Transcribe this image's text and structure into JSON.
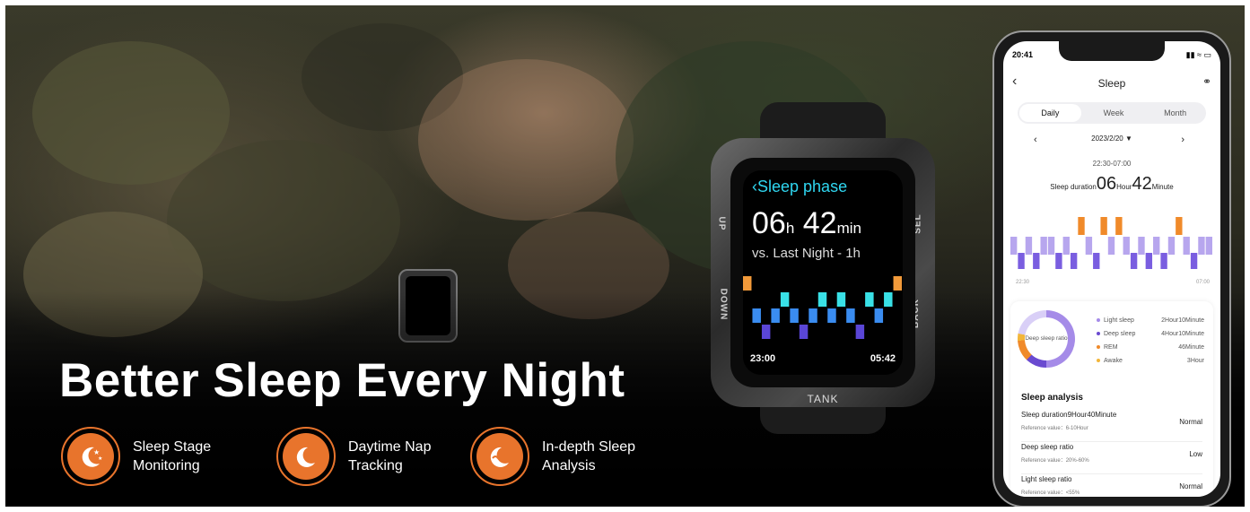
{
  "banner": {
    "headline": "Better Sleep Every Night",
    "features": [
      {
        "icon": "moon-stars-icon",
        "label": "Sleep Stage Monitoring"
      },
      {
        "icon": "moon-z-icon",
        "label": "Daytime Nap Tracking"
      },
      {
        "icon": "moon-wave-icon",
        "label": "In-depth Sleep Analysis"
      }
    ],
    "accent": "#e8742c"
  },
  "watch": {
    "title": "Sleep phase",
    "hours": "06",
    "hours_unit": "h",
    "minutes": "42",
    "minutes_unit": "min",
    "compare": "vs. Last Night - 1h",
    "start": "23:00",
    "end": "05:42",
    "brand": "TANK",
    "labels": {
      "up": "UP",
      "down": "DOWN",
      "back": "BACK",
      "sel": "SEL"
    }
  },
  "phone": {
    "status_time": "20:41",
    "title": "Sleep",
    "tabs": [
      "Daily",
      "Week",
      "Month"
    ],
    "active_tab": "Daily",
    "date": "2023/2/20",
    "range": "22:30-07:00",
    "duration_label": "Sleep duration",
    "duration_hours": "06",
    "hour_unit": "Hour",
    "duration_minutes": "42",
    "minute_unit": "Minute",
    "axis_start": "22:30",
    "axis_end": "07:00",
    "donut_label": "Deep sleep ratio",
    "legend": [
      {
        "name": "Light sleep",
        "value": "2Hour10Minute",
        "color": "#a58be8"
      },
      {
        "name": "Deep sleep",
        "value": "4Hour10Minute",
        "color": "#6a4ad0"
      },
      {
        "name": "REM",
        "value": "46Minute",
        "color": "#f08a2a"
      },
      {
        "name": "Awake",
        "value": "3Hour",
        "color": "#f2b63a"
      }
    ],
    "analysis_title": "Sleep analysis",
    "analysis": [
      {
        "name": "Sleep duration9Hour40Minute",
        "ref": "Reference value：6-10Hour",
        "status": "Normal"
      },
      {
        "name": "Deep sleep ratio",
        "ref": "Reference value：20%-60%",
        "status": "Low"
      },
      {
        "name": "Light sleep ratio",
        "ref": "Reference value：<55%",
        "status": "Normal"
      }
    ]
  }
}
